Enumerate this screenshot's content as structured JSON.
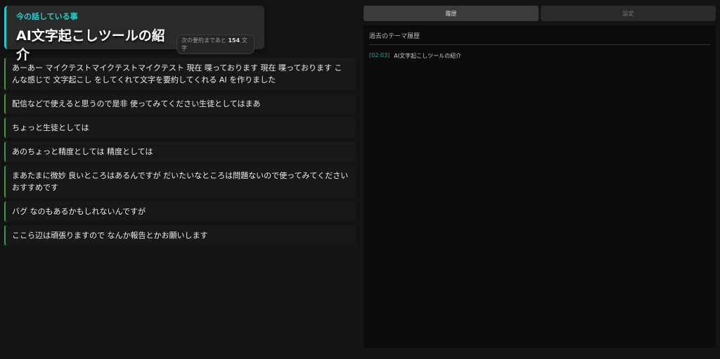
{
  "topic": {
    "label": "今の話している事",
    "title": "AI文字起こしツールの紹介",
    "badge_prefix": "次の要約まであと",
    "badge_count": "154",
    "badge_suffix": "文字"
  },
  "transcript": [
    "あーあー マイクテストマイクテストマイクテスト 現在 喋っております 現在 喋っております こんな感じで 文字起こし をしてくれて文字を要約してくれる AI を作りました",
    "配信などで使えると思うので是非 使ってみてください生徒としてはまあ",
    "ちょっと生徒としては",
    "あのちょっと精度としては 精度としては",
    "まあたまに微妙 良いところはあるんですが だいたいなところは問題ないので使ってみてください おすすめです",
    "バグ なのもあるかもしれないんですが",
    "ここら辺は頑張りますので なんか報告とかお願いします"
  ],
  "tabs": {
    "history": "履歴",
    "settings": "設定"
  },
  "history": {
    "title": "過去のテーマ履歴",
    "items": [
      {
        "time": "[02:03]",
        "title": "AI文字起こしツールの紹介"
      }
    ]
  }
}
